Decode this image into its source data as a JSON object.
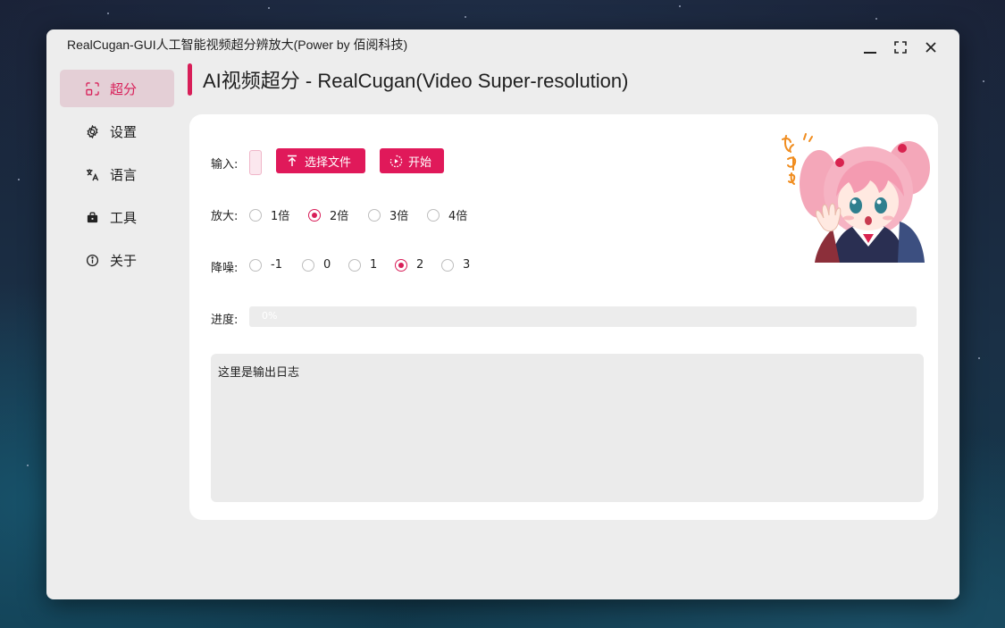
{
  "window": {
    "title": "RealCugan-GUI人工智能视频超分辨放大(Power by 佰阅科技)"
  },
  "nav": {
    "items": [
      {
        "label": "超分",
        "icon": "super-resolution-icon",
        "active": true
      },
      {
        "label": "设置",
        "icon": "gear-icon",
        "active": false
      },
      {
        "label": "语言",
        "icon": "translate-icon",
        "active": false
      },
      {
        "label": "工具",
        "icon": "toolbox-icon",
        "active": false
      },
      {
        "label": "关于",
        "icon": "info-icon",
        "active": false
      }
    ]
  },
  "page": {
    "title": "AI视频超分 - RealCugan(Video Super-resolution)"
  },
  "form": {
    "input_label": "输入:",
    "select_file_label": "选择文件",
    "start_label": "开始",
    "scale_label": "放大:",
    "scale_options": [
      "1倍",
      "2倍",
      "3倍",
      "4倍"
    ],
    "scale_selected": "2倍",
    "denoise_label": "降噪:",
    "denoise_options": [
      "-1",
      "0",
      "1",
      "2",
      "3"
    ],
    "denoise_selected": "2",
    "progress_label": "进度:",
    "progress_text": "0%",
    "progress_value": 0,
    "log_text": "这里是输出日志"
  },
  "colors": {
    "accent": "#e0195a",
    "window_bg": "#ededed",
    "card_bg": "#ffffff"
  }
}
